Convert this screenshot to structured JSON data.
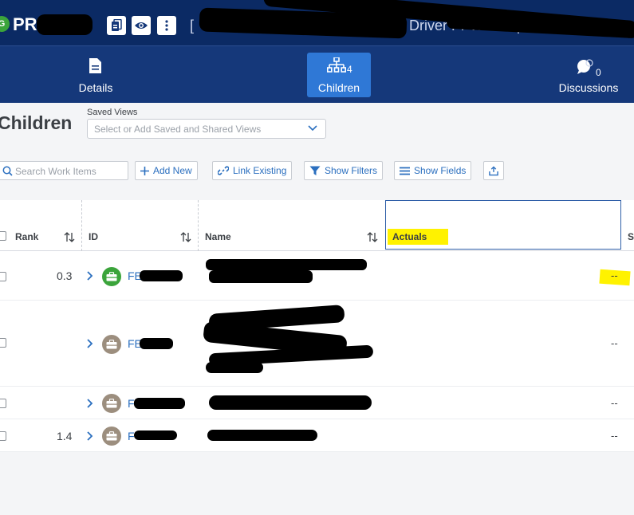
{
  "titlebar": {
    "prefix": "PR",
    "visible_title_fragment": "[",
    "visible_title_tail": "Driver Pr  Whi      Reporting"
  },
  "tabs": [
    {
      "label": "Details",
      "icon": "document-icon",
      "count": ""
    },
    {
      "label": "Children",
      "icon": "hierarchy-icon",
      "count": "4"
    },
    {
      "label": "Discussions",
      "icon": "chat-bubble-icon",
      "count": "0"
    }
  ],
  "heading": "Children",
  "saved_views": {
    "label": "Saved Views",
    "placeholder": "Select or Add Saved and Shared Views"
  },
  "toolbar": {
    "search_placeholder": "Search Work Items",
    "add_new": "Add New",
    "link_existing": "Link Existing",
    "show_filters": "Show Filters",
    "show_fields": "Show Fields"
  },
  "columns": {
    "rank": "Rank",
    "id": "ID",
    "name": "Name",
    "actuals": "Actuals",
    "next": "S"
  },
  "rows": [
    {
      "rank": "0.3",
      "id": "FE",
      "actuals": "--",
      "icon_color": "#3ba43b"
    },
    {
      "rank": "",
      "id": "FE",
      "actuals": "--",
      "icon_color": "#9c8e7e"
    },
    {
      "rank": "",
      "id": "F",
      "actuals": "--",
      "icon_color": "#9c8e7e"
    },
    {
      "rank": "1.4",
      "id": "F",
      "actuals": "--",
      "icon_color": "#9c8e7e"
    }
  ],
  "colors": {
    "titlebar": "#0b2a64",
    "tabbar": "#15387a",
    "active_tab": "#2f78d6",
    "link": "#2b6fbf",
    "highlight": "#fff200"
  }
}
